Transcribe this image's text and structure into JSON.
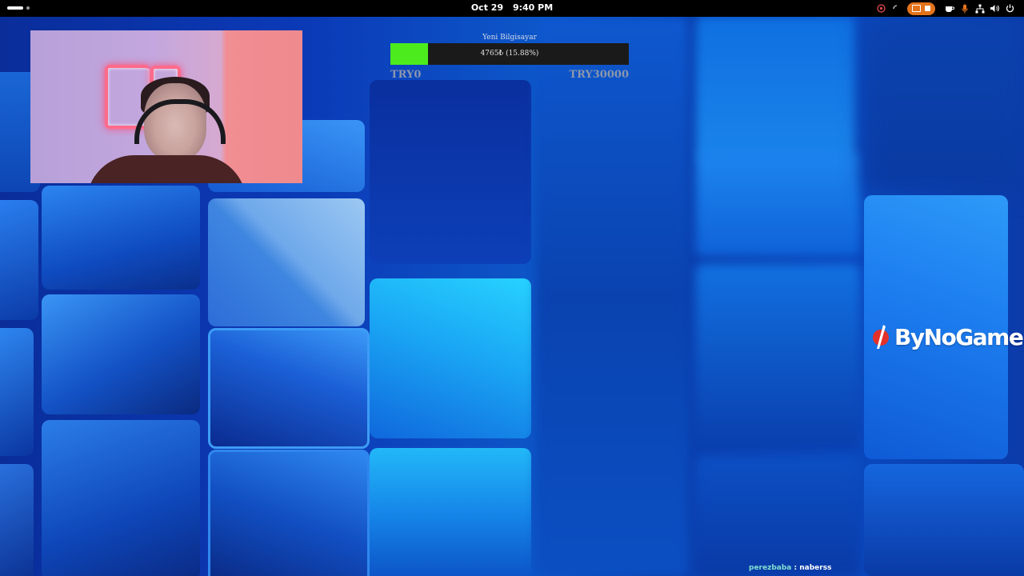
{
  "topbar": {
    "date": "Oct 29",
    "time": "9:40 PM",
    "tray_icons": [
      "color-picker-icon",
      "loading-spinner-icon",
      "screencast-icon",
      "stop-icon",
      "coffee-icon",
      "microphone-icon",
      "network-icon",
      "volume-icon",
      "power-icon"
    ]
  },
  "webcam": {
    "description_icon": "webcam-feed"
  },
  "goal": {
    "title": "Yeni Bilgisayar",
    "progress_text": "4765₺ (15.88%)",
    "progress_fraction": 0.1588,
    "min_label": "TRY0",
    "max_label": "TRY30000",
    "fill_color": "#4ceb1e"
  },
  "logo": {
    "text": "ByNoGame",
    "accent": "#e2302b"
  },
  "chat": {
    "user": "perezbaba",
    "separator": ":",
    "message": "naberss"
  },
  "colors": {
    "wallpaper_base": "#0b3ab7",
    "recording_accent": "#e3731b"
  }
}
